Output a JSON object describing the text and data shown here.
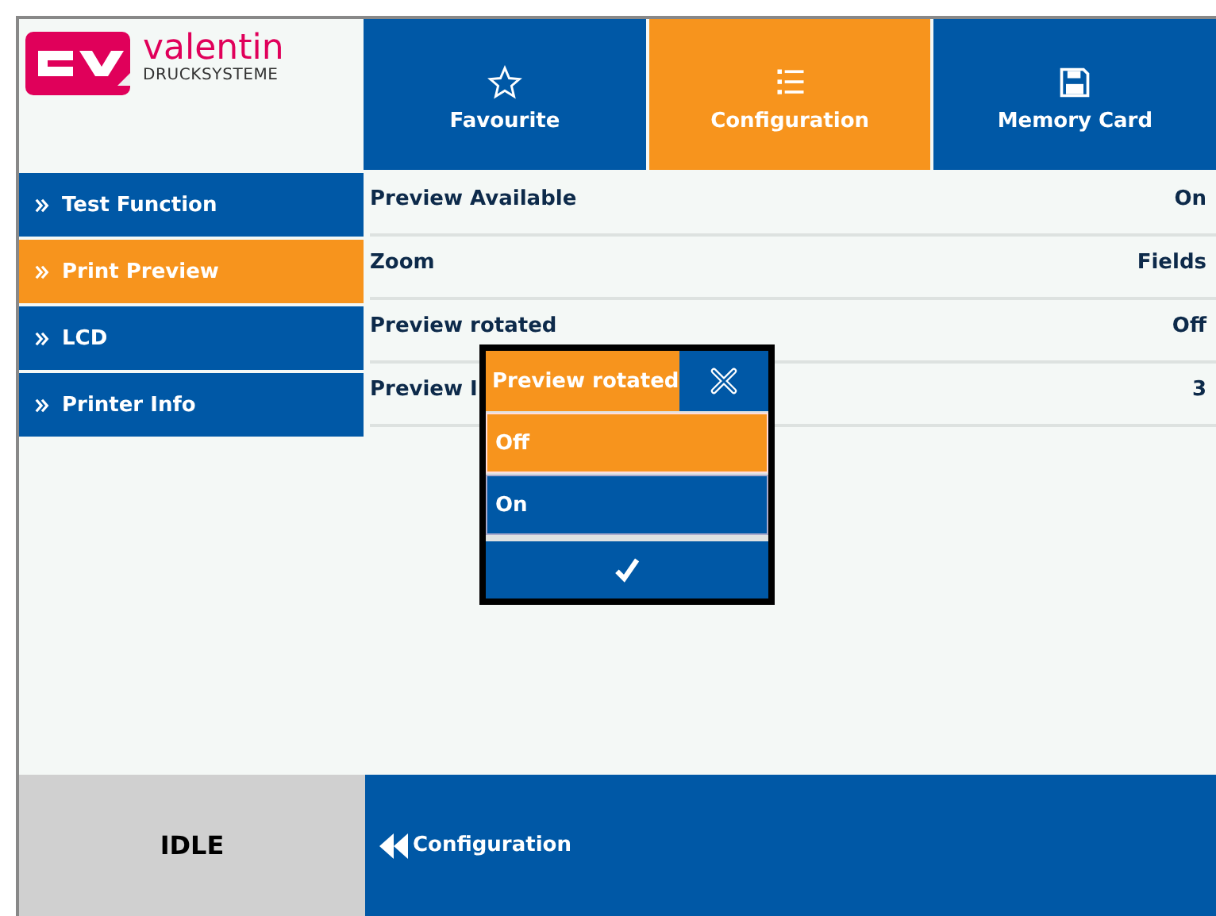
{
  "logo": {
    "name": "valentin",
    "subtitle": "DRUCKSYSTEME"
  },
  "tabs": [
    {
      "label": "Favourite",
      "kind": "star",
      "selected": false
    },
    {
      "label": "Configuration",
      "kind": "list",
      "selected": true
    },
    {
      "label": "Memory Card",
      "kind": "disk",
      "selected": false
    }
  ],
  "sidebar": {
    "items": [
      {
        "label": "Test Function",
        "selected": false
      },
      {
        "label": "Print Preview",
        "selected": true
      },
      {
        "label": "LCD",
        "selected": false
      },
      {
        "label": "Printer Info",
        "selected": false
      }
    ]
  },
  "settings": [
    {
      "label": "Preview Available",
      "value": "On"
    },
    {
      "label": "Zoom",
      "value": "Fields"
    },
    {
      "label": "Preview rotated",
      "value": "Off"
    },
    {
      "label": "Preview I",
      "value": "3"
    }
  ],
  "dialog": {
    "title": "Preview rotated",
    "options": [
      {
        "label": "Off",
        "selected": true
      },
      {
        "label": "On",
        "selected": false
      }
    ]
  },
  "status": "IDLE",
  "back": {
    "label": "Configuration"
  }
}
